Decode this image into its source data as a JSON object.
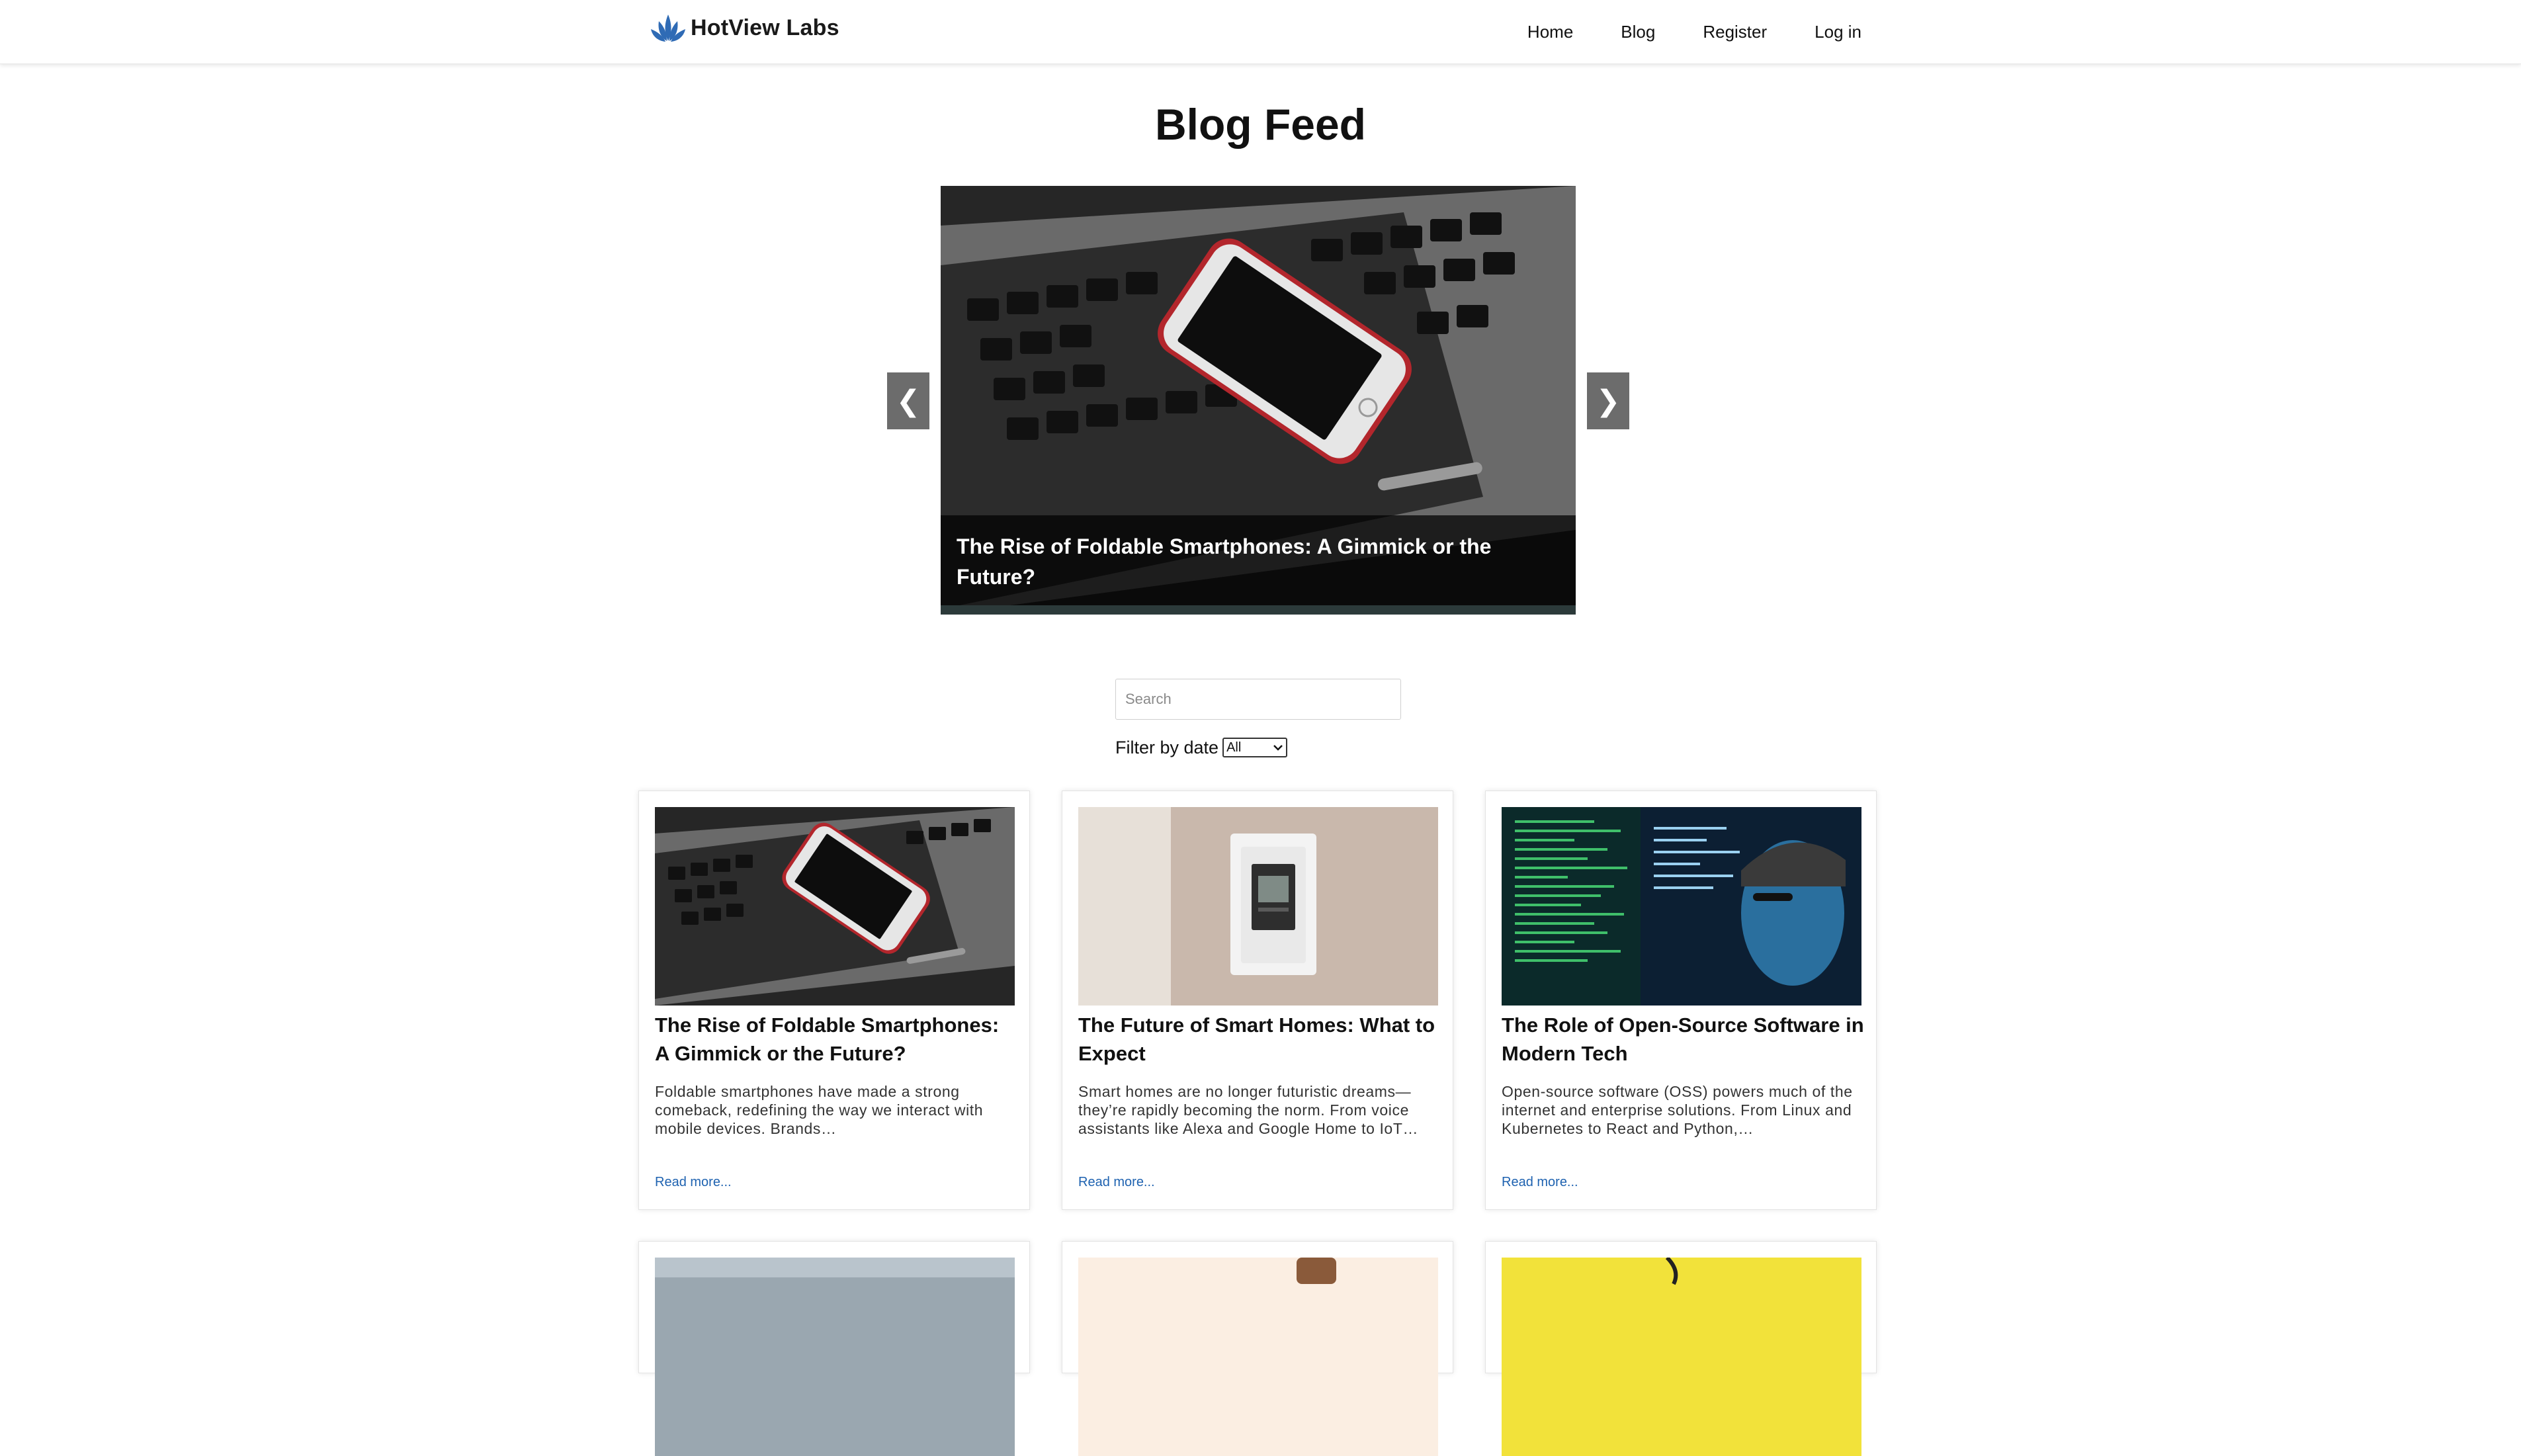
{
  "navbar": {
    "brand": "HotView Labs",
    "links": [
      "Home",
      "Blog",
      "Register",
      "Log in"
    ]
  },
  "page": {
    "title": "Blog Feed"
  },
  "carousel": {
    "caption": "The Rise of Foldable Smartphones: A Gimmick or the Future?",
    "prev_label": "❮",
    "next_label": "❯"
  },
  "search": {
    "placeholder": "Search",
    "value": ""
  },
  "filter": {
    "label": "Filter by date",
    "selected": "All"
  },
  "posts": [
    {
      "title": "The Rise of Foldable Smartphones: A Gimmick or the Future?",
      "excerpt": "Foldable smartphones have made a strong comeback, redefining the way we interact with mobile devices. Brands…",
      "read_more": "Read more..."
    },
    {
      "title": "The Future of Smart Homes: What to Expect",
      "excerpt": "Smart homes are no longer futuristic dreams—they’re rapidly becoming the norm. From voice assistants like Alexa and Google Home to IoT…",
      "read_more": "Read more..."
    },
    {
      "title": "The Role of Open-Source Software in Modern Tech",
      "excerpt": "Open-source software (OSS) powers much of the internet and enterprise solutions. From Linux and Kubernetes to React and Python,…",
      "read_more": "Read more..."
    }
  ],
  "colors": {
    "link": "#1e62b0",
    "brand_icon": "#2f6bb5",
    "carousel_button": "#6c6c6c"
  },
  "icons": {
    "brand": "lotus-logo-icon",
    "prev": "chevron-left-icon",
    "next": "chevron-right-icon",
    "select": "chevron-down-icon"
  }
}
